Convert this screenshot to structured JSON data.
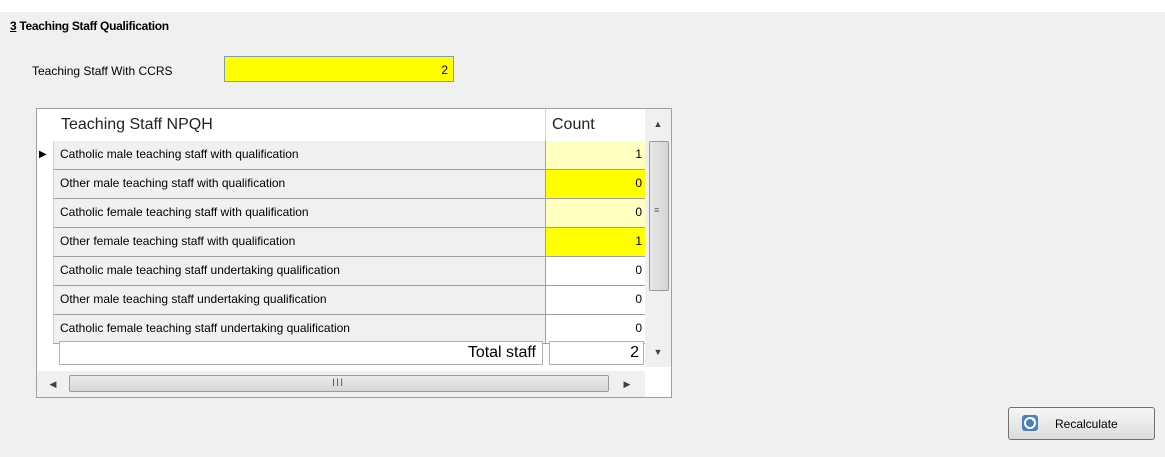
{
  "section": {
    "number": "3",
    "title": "Teaching Staff Qualification"
  },
  "ccrs": {
    "label": "Teaching Staff With CCRS",
    "value": "2",
    "color": "#ffff00"
  },
  "grid": {
    "headers": {
      "name": "Teaching Staff NPQH",
      "count": "Count"
    },
    "rows": [
      {
        "label": "Catholic male teaching staff with qualification",
        "count": "1",
        "bg": "#ffffc0",
        "selected": true
      },
      {
        "label": "Other male teaching staff with qualification",
        "count": "0",
        "bg": "#ffff00"
      },
      {
        "label": "Catholic female teaching staff with qualification",
        "count": "0",
        "bg": "#ffffc0"
      },
      {
        "label": "Other female teaching staff with qualification",
        "count": "1",
        "bg": "#ffff00"
      },
      {
        "label": "Catholic male teaching staff undertaking qualification",
        "count": "0",
        "bg": "#ffffff"
      },
      {
        "label": "Other male teaching staff undertaking qualification",
        "count": "0",
        "bg": "#ffffff"
      },
      {
        "label": "Catholic female teaching staff undertaking qualification",
        "count": "0",
        "bg": "#ffffff"
      }
    ],
    "total": {
      "label": "Total staff",
      "value": "2"
    },
    "name_column_bg": "#f0f0f0"
  },
  "scrollbars": {
    "up_icon": "triangle-up",
    "down_icon": "triangle-down",
    "left_icon": "triangle-left",
    "right_icon": "triangle-right",
    "h_grip": "III",
    "v_grip": "≡"
  },
  "recalculate": {
    "label": "Recalculate",
    "icon": "recalculate-icon"
  }
}
